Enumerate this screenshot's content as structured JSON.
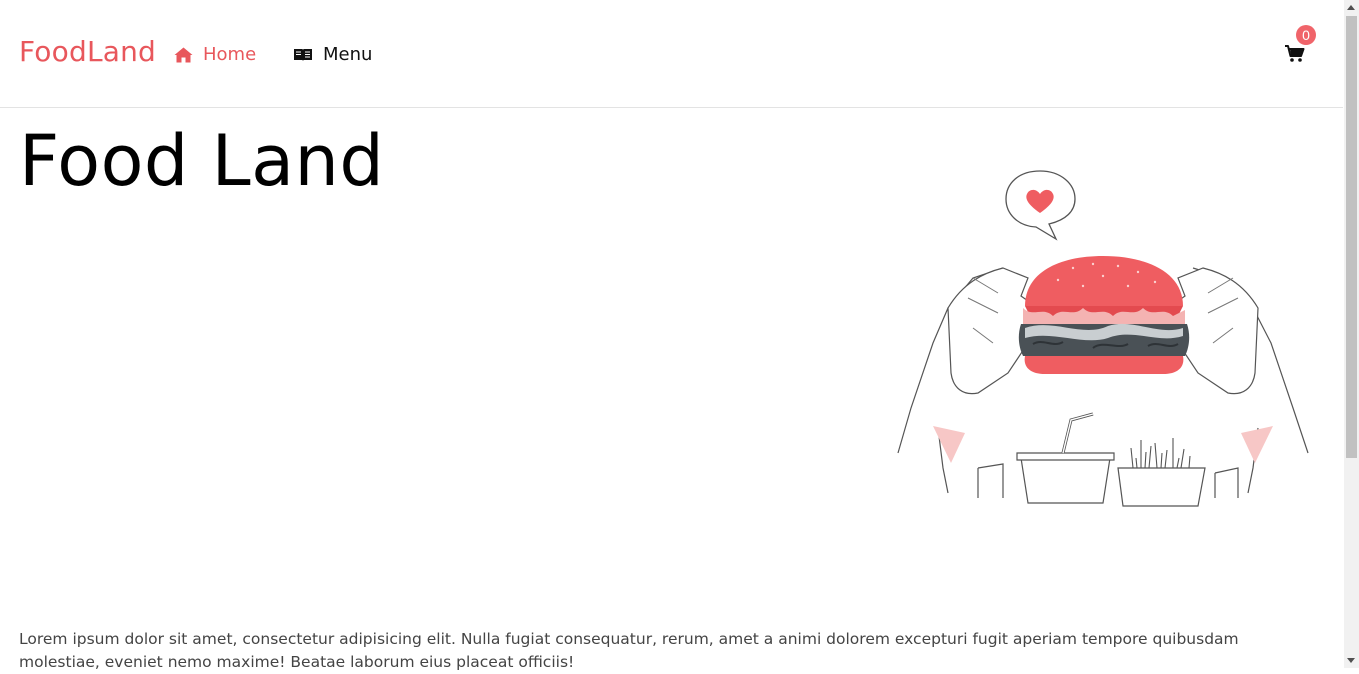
{
  "nav": {
    "brand": "FoodLand",
    "links": [
      {
        "label": "Home",
        "icon": "home-icon",
        "active": true
      },
      {
        "label": "Menu",
        "icon": "book-icon",
        "active": false
      }
    ],
    "cart": {
      "icon": "cart-icon",
      "count": "0"
    }
  },
  "hero": {
    "title": "Food Land",
    "image": "burger-illustration",
    "description": "Lorem ipsum dolor sit amet, consectetur adipisicing elit. Nulla fugiat consequatur, rerum, amet a animi dolorem excepturi fugit aperiam tempore quibusdam molestiae, eveniet nemo maxime! Beatae laborum eius placeat officiis!"
  },
  "colors": {
    "accent": "#e8575c",
    "badge": "#f0646a",
    "text": "#000000"
  }
}
